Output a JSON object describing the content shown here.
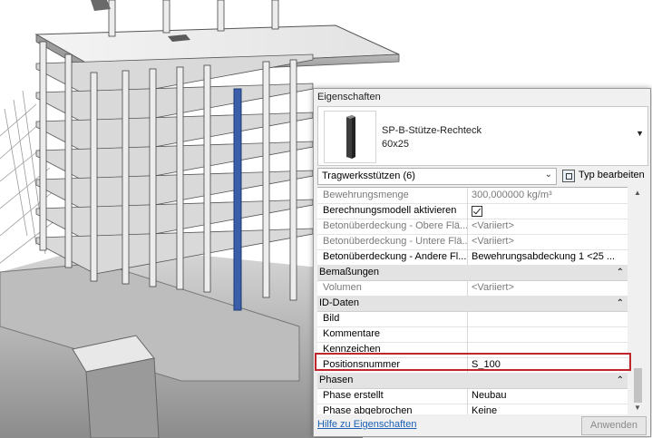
{
  "panel": {
    "title": "Eigenschaften",
    "type_name": "SP-B-Stütze-Rechteck",
    "type_size": "60x25",
    "filter_label": "Tragwerksstützen (6)",
    "edit_type_label": "Typ bearbeiten",
    "help_link": "Hilfe zu Eigenschaften",
    "apply_label": "Anwenden",
    "rows": [
      {
        "name": "Bewehrungsmenge",
        "value": "300,000000 kg/m³"
      },
      {
        "name": "Berechnungsmodell aktivieren",
        "value": ""
      },
      {
        "name": "Betonüberdeckung - Obere Flä...",
        "value": "<Variiert>"
      },
      {
        "name": "Betonüberdeckung - Untere Flä...",
        "value": "<Variiert>"
      },
      {
        "name": "Betonüberdeckung - Andere Fl...",
        "value": "Bewehrungsabdeckung 1 <25 ..."
      },
      {
        "name": "Bemaßungen"
      },
      {
        "name": "Volumen",
        "value": "<Variiert>"
      },
      {
        "name": "ID-Daten"
      },
      {
        "name": "Bild",
        "value": ""
      },
      {
        "name": "Kommentare",
        "value": ""
      },
      {
        "name": "Kennzeichen",
        "value": ""
      },
      {
        "name": "Positionsnummer",
        "value": "S_100"
      },
      {
        "name": "Phasen"
      },
      {
        "name": "Phase erstellt",
        "value": "Neubau"
      },
      {
        "name": "Phase abgebrochen",
        "value": "Keine"
      }
    ]
  }
}
